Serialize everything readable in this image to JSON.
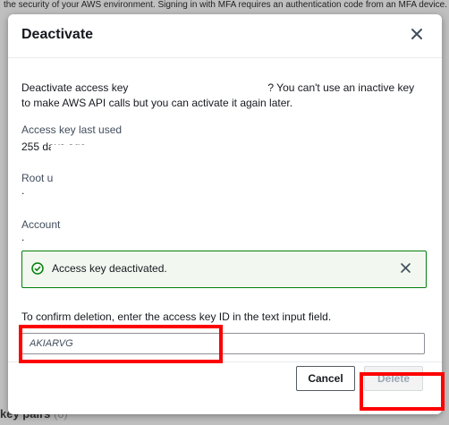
{
  "background": {
    "top_text": "the security of your AWS environment. Signing in with MFA requires an authentication code from an MFA device.",
    "section_fragment": "key pairs",
    "section_count": "(0)"
  },
  "modal": {
    "title": "Deactivate",
    "description_start": "Deactivate access key",
    "description_end": "? You can't use an inactive key to make AWS API calls but you can activate it again later.",
    "fields": [
      {
        "label": "Access key last used",
        "value": "255 days ago"
      },
      {
        "label": "Root user",
        "value": "."
      },
      {
        "label": "Account",
        "value": "."
      }
    ],
    "alert": {
      "text": "Access key deactivated.",
      "color": "#037f0c"
    },
    "confirm_label": "To confirm deletion, enter the access key ID in the text input field.",
    "input_value": "AKIARVG",
    "cancel_label": "Cancel",
    "delete_label": "Delete"
  }
}
